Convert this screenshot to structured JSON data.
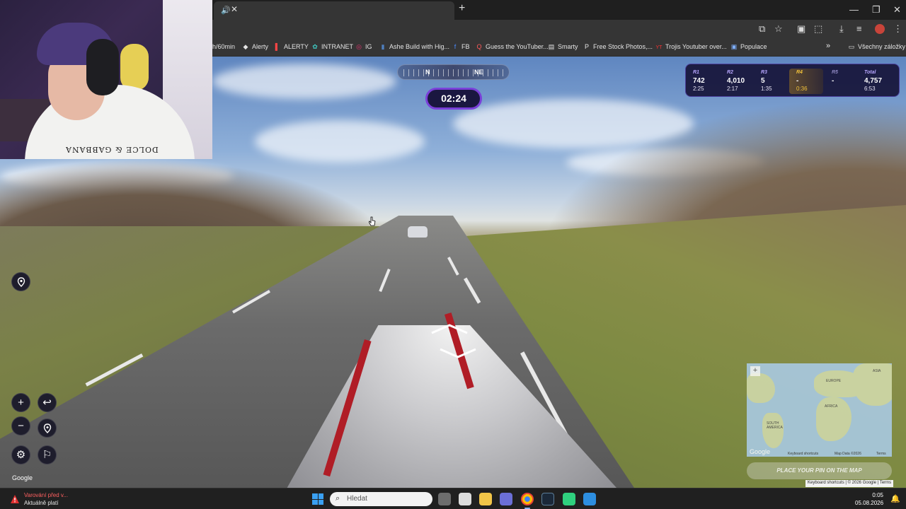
{
  "browser": {
    "tab_audio_icon": "speaker-icon",
    "tab_close": "✕",
    "new_tab": "+",
    "window_controls": {
      "minimize": "—",
      "maximize": "❐",
      "close": "✕"
    },
    "toolbar_icons": [
      "cast-icon",
      "star-icon",
      "extension-icon",
      "puzzle-icon",
      "download-icon",
      "media-icon",
      "profile-avatar",
      "menu-icon"
    ],
    "bookmarks": [
      {
        "label": "h/60min",
        "icon": ""
      },
      {
        "label": "Alerty",
        "icon": "◆"
      },
      {
        "label": "ALERTY",
        "icon": "▌"
      },
      {
        "label": "INTRANET",
        "icon": "✿"
      },
      {
        "label": "IG",
        "icon": "◎"
      },
      {
        "label": "Ashe Build with Hig...",
        "icon": "▮"
      },
      {
        "label": "FB",
        "icon": "f"
      },
      {
        "label": "Guess the YouTuber...",
        "icon": "Q"
      },
      {
        "label": "Smarty",
        "icon": "▤"
      },
      {
        "label": "Free Stock Photos,...",
        "icon": "P"
      },
      {
        "label": "Trojis Youtuber over...",
        "icon": "YT"
      },
      {
        "label": "Populace",
        "icon": "▣"
      }
    ],
    "bookmarks_overflow": "»",
    "all_bookmarks": "Všechny záložky"
  },
  "game": {
    "compass": {
      "left": "N",
      "right": "NE"
    },
    "timer": "02:24",
    "rounds": [
      {
        "label": "R1",
        "points": "742",
        "time": "2:25"
      },
      {
        "label": "R2",
        "points": "4,010",
        "time": "2:17"
      },
      {
        "label": "R3",
        "points": "5",
        "time": "1:35"
      },
      {
        "label": "R4",
        "points": "-",
        "time": "0:36"
      },
      {
        "label": "R5",
        "points": "-",
        "time": ""
      },
      {
        "label": "Total",
        "points": "4,757",
        "time": "6:53"
      }
    ],
    "controls": {
      "zoom_in": "+",
      "zoom_out": "−",
      "back_icon": "undo-arrow-icon",
      "checkpoint_icon": "pin-plus-icon",
      "settings_icon": "gear-icon",
      "flag_icon": "flag-icon",
      "location_icon": "location-pin-icon"
    },
    "google_logo": "Google",
    "minimap": {
      "labels": [
        "EUROPE",
        "ASIA",
        "AFRICA",
        "SOUTH AMERICA"
      ],
      "zoom": "+",
      "google": "Google",
      "footer_shortcuts": "Keyboard shortcuts",
      "footer_data": "Map Data ©2026",
      "footer_terms": "Terms"
    },
    "place_pin": "PLACE YOUR PIN ON THE MAP",
    "attribution": "Keyboard shortcuts  |  © 2026 Google  |  Terms"
  },
  "webcam": {
    "shirt_print": "DOLCE & GABBANA"
  },
  "taskbar": {
    "notification_title": "Varování před v...",
    "notification_sub": "Aktuálně platí",
    "search_placeholder": "Hledat",
    "apps": [
      "task-view-icon",
      "store-icon",
      "file-explorer-icon",
      "teams-icon",
      "chrome-icon",
      "steam-icon",
      "discord-icon",
      "app-icon"
    ],
    "time": "0:05",
    "date": "05.08.2026"
  },
  "colors": {
    "accent_purple": "#7a40d9",
    "hud_bg": "#161438",
    "active_round": "#f2c23a"
  }
}
